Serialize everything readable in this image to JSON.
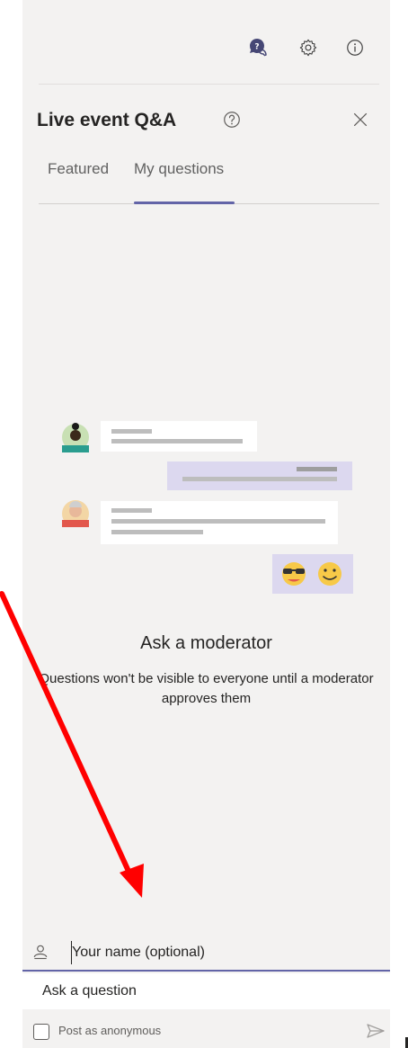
{
  "header": {
    "title": "Live event Q&A"
  },
  "toolbar": {
    "icons": [
      "qna-bubble-icon",
      "settings-gear-icon",
      "info-icon"
    ]
  },
  "tabs": [
    {
      "label": "Featured",
      "active": false
    },
    {
      "label": "My questions",
      "active": true
    }
  ],
  "empty_state": {
    "title": "Ask a moderator",
    "description": "Questions won't be visible to everyone until a moderator approves them"
  },
  "composer": {
    "name_placeholder": "Your name (optional)",
    "question_placeholder": "Ask a question",
    "anonymous_label": "Post as anonymous",
    "anonymous_checked": false
  },
  "colors": {
    "accent": "#6264a7",
    "panel_background": "#f3f2f1",
    "bubble_lavender": "#dcd8ef",
    "annotation_arrow": "#ff0000"
  }
}
